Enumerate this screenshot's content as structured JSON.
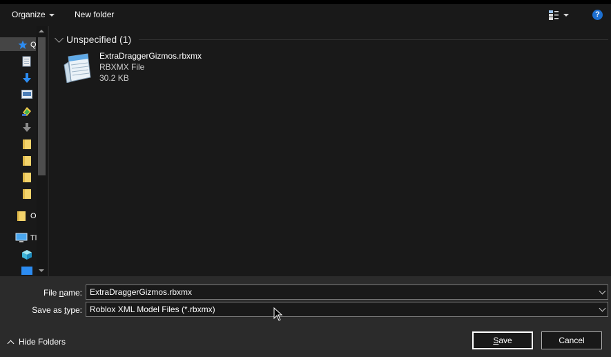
{
  "toolbar": {
    "organize_label": "Organize",
    "new_folder_label": "New folder",
    "help_label": "?"
  },
  "nav": {
    "items": [
      {
        "icon": "star-icon",
        "label": "Q"
      },
      {
        "icon": "document-icon",
        "label": ""
      },
      {
        "icon": "download-icon",
        "label": ""
      },
      {
        "icon": "image-icon",
        "label": ""
      },
      {
        "icon": "app-icon",
        "label": ""
      },
      {
        "icon": "arrow-down-icon",
        "label": ""
      },
      {
        "icon": "folder-icon",
        "label": ""
      },
      {
        "icon": "folder-icon",
        "label": ""
      },
      {
        "icon": "folder-icon",
        "label": ""
      },
      {
        "icon": "folder-icon",
        "label": ""
      },
      {
        "icon": "folder-icon",
        "label": "O"
      },
      {
        "icon": "monitor-icon",
        "label": "Tl"
      },
      {
        "icon": "cube-icon",
        "label": ""
      },
      {
        "icon": "desktop-icon",
        "label": ""
      }
    ]
  },
  "content": {
    "group_title": "Unspecified (1)",
    "file": {
      "name": "ExtraDraggerGizmos.rbxmx",
      "type": "RBXMX File",
      "size": "30.2 KB"
    }
  },
  "form": {
    "file_name_label_prefix": "File ",
    "file_name_label_accel": "n",
    "file_name_label_suffix": "ame:",
    "file_name_value": "ExtraDraggerGizmos.rbxmx",
    "save_type_label_prefix": "Save as ",
    "save_type_label_accel": "t",
    "save_type_label_suffix": "ype:",
    "save_type_value": "Roblox XML Model Files (*.rbxmx)"
  },
  "footer": {
    "hide_folders_label": "Hide Folders",
    "save_accel": "S",
    "save_rest": "ave",
    "cancel_label": "Cancel"
  },
  "colors": {
    "background": "#191919",
    "bottom_panel": "#2b2b2b",
    "help_blue": "#1c6fd1",
    "folder_yellow": "#f3d36b"
  }
}
